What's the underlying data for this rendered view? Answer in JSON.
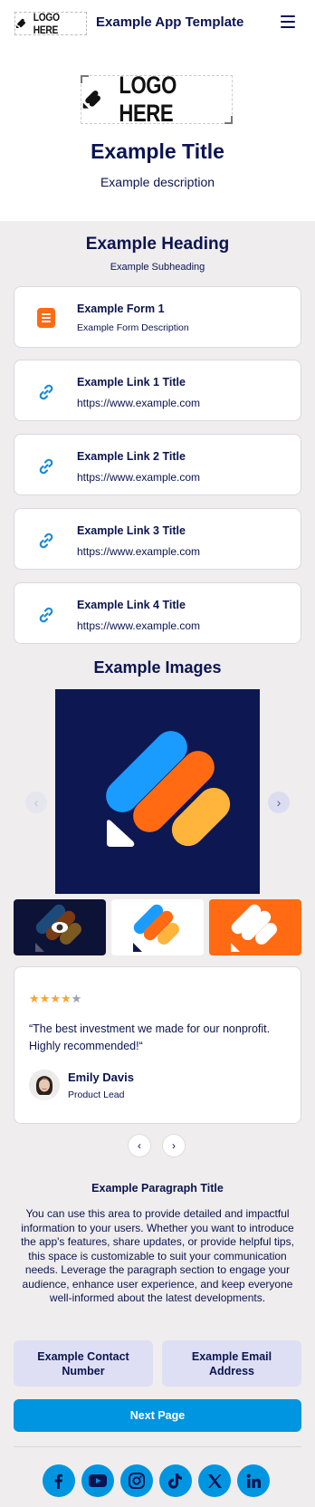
{
  "header": {
    "logo_text": "LOGO HERE",
    "app_title": "Example App Template",
    "menu_icon": "hamburger-menu-icon"
  },
  "hero": {
    "logo_text": "LOGO HERE",
    "title": "Example Title",
    "description": "Example description"
  },
  "section": {
    "heading": "Example Heading",
    "subheading": "Example Subheading"
  },
  "form": {
    "title": "Example Form 1",
    "description": "Example Form Description",
    "icon": "form-document-icon"
  },
  "links": [
    {
      "title": "Example Link 1 Title",
      "url": "https://www.example.com",
      "icon": "link-icon"
    },
    {
      "title": "Example Link 2 Title",
      "url": "https://www.example.com",
      "icon": "link-icon"
    },
    {
      "title": "Example Link 3 Title",
      "url": "https://www.example.com",
      "icon": "link-icon"
    },
    {
      "title": "Example Link 4 Title",
      "url": "https://www.example.com",
      "icon": "link-icon"
    }
  ],
  "images": {
    "heading": "Example Images",
    "prev_icon": "chevron-left-icon",
    "next_icon": "chevron-right-icon"
  },
  "review": {
    "rating": 4,
    "max_rating": 5,
    "quote": "“The best investment we made for our nonprofit. Highly recommended!“",
    "name": "Emily Davis",
    "role": "Product Lead"
  },
  "paragraph": {
    "title": "Example Paragraph Title",
    "text": "You can use this area to provide detailed and impactful information to your users. Whether you want to introduce the app's features, share updates, or provide helpful tips, this space is customizable to suit your communication needs. Leverage the paragraph section to engage your audience, enhance user experience, and keep everyone well-informed about the latest developments."
  },
  "contact": {
    "number_label": "Example Contact Number",
    "email_label": "Example Email Address"
  },
  "next_button": "Next Page",
  "social": [
    "facebook-icon",
    "youtube-icon",
    "instagram-icon",
    "tiktok-icon",
    "x-icon",
    "linkedin-icon"
  ],
  "colors": {
    "navy": "#0b1450",
    "accent_blue": "#0095e0",
    "brand_orange": "#ff6a13",
    "brand_yellow": "#ffb43b",
    "brand_light_blue": "#1a9cff",
    "background": "#efeded"
  }
}
